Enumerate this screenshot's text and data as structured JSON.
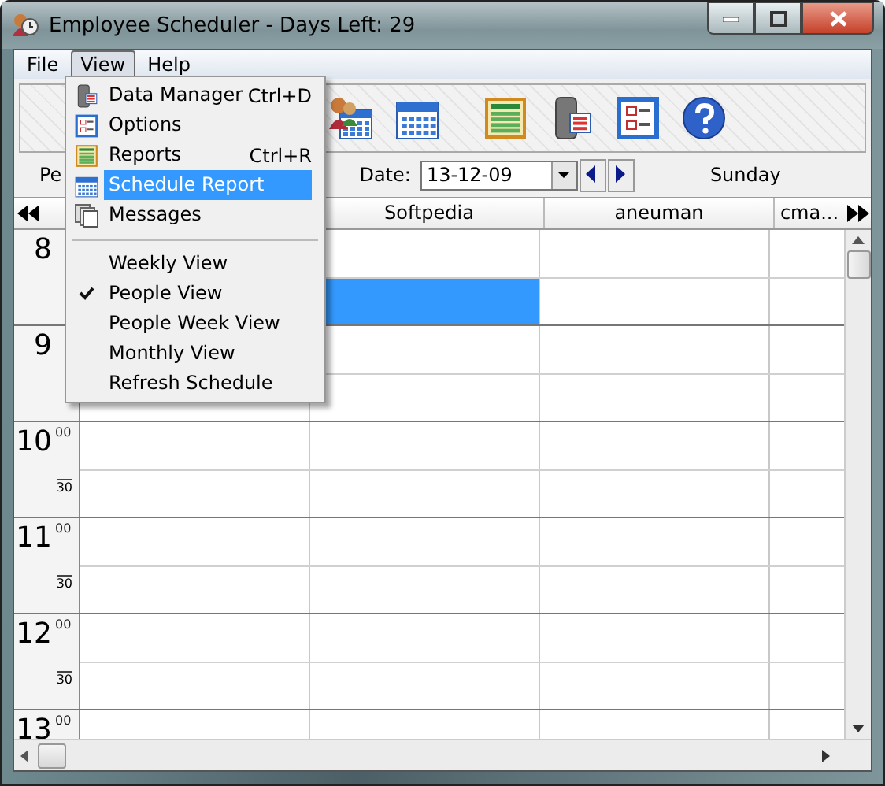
{
  "window": {
    "title": "Employee Scheduler - Days Left:  29"
  },
  "menu_bar": [
    {
      "label": "File",
      "selected": false
    },
    {
      "label": "View",
      "selected": true
    },
    {
      "label": "Help",
      "selected": false
    }
  ],
  "toolbar": [
    {
      "kind": "people"
    },
    {
      "kind": "calendar"
    },
    {
      "kind": "sheet"
    },
    {
      "kind": "database"
    },
    {
      "kind": "checklist"
    },
    {
      "kind": "help"
    }
  ],
  "date_bar": {
    "cut_label": "Pe",
    "date_label": "Date:",
    "date_value": "13-12-09",
    "day": "Sunday"
  },
  "grid": {
    "columns": [
      {
        "label": "Softpedia"
      },
      {
        "label": "aneuman"
      },
      {
        "label": "cma..."
      }
    ],
    "hours": [
      {
        "hour": "8",
        "selected": [
          [
            false,
            false,
            false
          ],
          [
            true,
            false,
            false
          ]
        ]
      },
      {
        "hour": "9",
        "selected": [
          [
            false,
            false,
            false
          ],
          [
            false,
            false,
            false
          ]
        ]
      },
      {
        "hour": "10",
        "minutes": "00",
        "half": "30",
        "selected": [
          [
            false,
            false,
            false,
            false
          ],
          [
            false,
            false,
            false,
            false
          ]
        ]
      },
      {
        "hour": "11",
        "minutes": "00",
        "half": "30",
        "selected": [
          [
            false,
            false,
            false,
            false
          ],
          [
            false,
            false,
            false,
            false
          ]
        ]
      },
      {
        "hour": "12",
        "minutes": "00",
        "half": "30",
        "selected": [
          [
            false,
            false,
            false,
            false
          ],
          [
            false,
            false,
            false,
            false
          ]
        ]
      },
      {
        "hour": "13",
        "minutes": "00",
        "selected": [
          [
            false,
            false,
            false,
            false
          ]
        ]
      }
    ]
  },
  "view_menu": [
    {
      "kind": "item",
      "label": "Data Manager",
      "shortcut": "Ctrl+D",
      "selected": false
    },
    {
      "kind": "item",
      "label": "Options",
      "selected": false
    },
    {
      "kind": "item",
      "label": "Reports",
      "shortcut": "Ctrl+R",
      "selected": false
    },
    {
      "kind": "item",
      "label": "Schedule Report",
      "selected": true
    },
    {
      "kind": "item",
      "label": "Messages",
      "selected": false
    },
    {
      "kind": "separator"
    },
    {
      "kind": "option",
      "label": "Weekly View",
      "checked": false
    },
    {
      "kind": "option",
      "label": "People View",
      "checked": true
    },
    {
      "kind": "option",
      "label": "People Week View",
      "checked": false
    },
    {
      "kind": "option",
      "label": "Monthly View",
      "checked": false
    },
    {
      "kind": "option",
      "label": "Refresh Schedule",
      "checked": false
    }
  ]
}
